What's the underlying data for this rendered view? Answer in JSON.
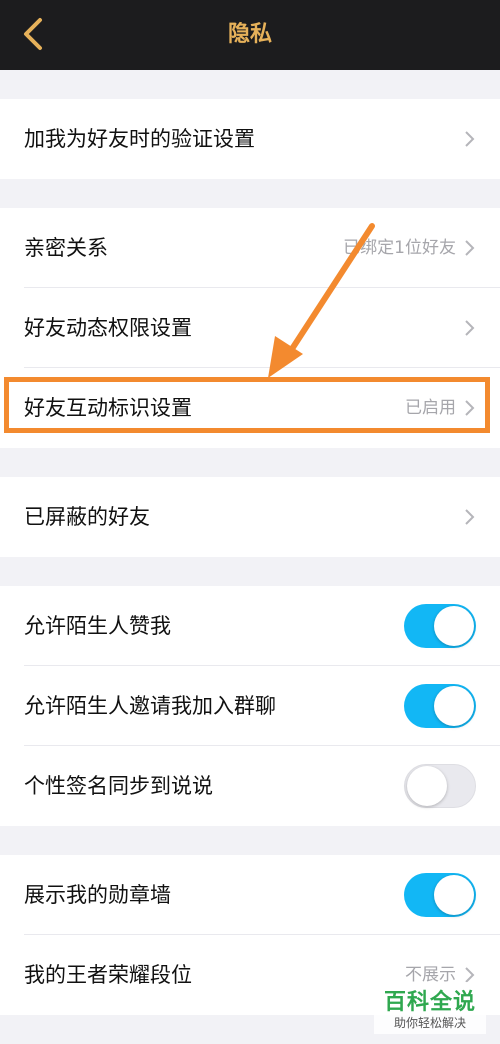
{
  "header": {
    "title": "隐私",
    "back_icon": "back-arrow-icon"
  },
  "groups": [
    {
      "rows": [
        {
          "label": "加我为好友时的验证设置",
          "value": ""
        }
      ]
    },
    {
      "rows": [
        {
          "label": "亲密关系",
          "value": "已绑定1位好友"
        },
        {
          "label": "好友动态权限设置",
          "value": ""
        },
        {
          "label": "好友互动标识设置",
          "value": "已启用"
        }
      ]
    },
    {
      "rows": [
        {
          "label": "已屏蔽的好友",
          "value": ""
        }
      ]
    },
    {
      "rows": [
        {
          "label": "允许陌生人赞我",
          "toggle": true
        },
        {
          "label": "允许陌生人邀请我加入群聊",
          "toggle": true
        },
        {
          "label": "个性签名同步到说说",
          "toggle": false
        }
      ]
    },
    {
      "rows": [
        {
          "label": "展示我的勋章墙",
          "toggle": true
        },
        {
          "label": "我的王者荣耀段位",
          "value": "不展示"
        }
      ]
    }
  ],
  "watermark": {
    "title": "百科全说",
    "subtitle": "助你轻松解决"
  },
  "colors": {
    "accent": "#e6b15a",
    "toggle_on": "#12b7f5",
    "highlight": "#f38a2f",
    "watermark": "#2fa84f"
  }
}
